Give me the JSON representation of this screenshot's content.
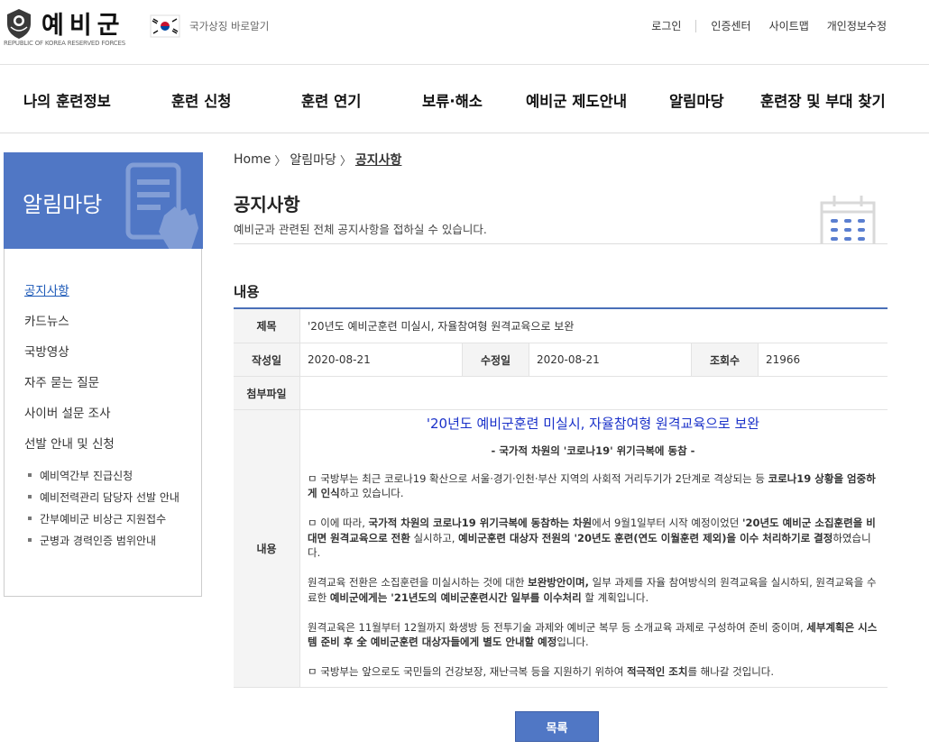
{
  "header": {
    "logo_text": "예비군",
    "logo_sub": "REPUBLIC OF KOREA RESERVED FORCES",
    "symbol_link": "국가상징 바로알기",
    "util": [
      "로그인",
      "인증센터",
      "사이트맵",
      "개인정보수정"
    ]
  },
  "gnb": [
    "나의 훈련정보",
    "훈련 신청",
    "훈련 연기",
    "보류·해소",
    "예비군 제도안내",
    "알림마당",
    "훈련장 및 부대 찾기"
  ],
  "sidebar": {
    "title": "알림마당",
    "items": [
      "공지사항",
      "카드뉴스",
      "국방영상",
      "자주 묻는 질문",
      "사이버 설문 조사",
      "선발 안내 및 신청"
    ],
    "active_index": 0,
    "sub_items": [
      "예비역간부 진급신청",
      "예비전력관리 담당자 선발 안내",
      "간부예비군 비상근 지원접수",
      "군병과 경력인증 범위안내"
    ]
  },
  "breadcrumb": [
    "Home",
    "알림마당",
    "공지사항"
  ],
  "page": {
    "title": "공지사항",
    "desc": "예비군과 관련된 전체 공지사항을 접하실 수 있습니다.",
    "section_title": "내용"
  },
  "post": {
    "labels": {
      "subject": "제목",
      "written": "작성일",
      "modified": "수정일",
      "views": "조회수",
      "attachment": "첨부파일",
      "content": "내용"
    },
    "subject": "'20년도 예비군훈련 미실시, 자율참여형 원격교육으로 보완",
    "written": "2020-08-21",
    "modified": "2020-08-21",
    "views": "21966",
    "attachment": "",
    "body": {
      "heading": "'20년도 예비군훈련 미실시, 자율참여형 원격교육으로 보완",
      "subheading": "- 국가적 차원의 '코로나19' 위기극복에 동참 -",
      "p1_a": "ㅁ 국방부는 최근 코로나19 확산으로 서울·경기·인천·부산 지역의 사회적 거리두기가 2단계로 격상되는 등 ",
      "p1_b": "코로나19 상황을 엄중하게 인식",
      "p1_c": "하고 있습니다.",
      "p2_a": "ㅁ 이에 따라, ",
      "p2_b": "국가적 차원의 코로나19 위기극복에 동참하는 차원",
      "p2_c": "에서 9월1일부터 시작 예정이었던 ",
      "p2_d": "'20년도 예비군 소집훈련을 비대면 원격교육으로 전환",
      "p2_e": " 실시하고, ",
      "p2_f": "예비군훈련 대상자 전원의 '20년도 훈련(연도 이월훈련 제외)을 이수 처리하기로 결정",
      "p2_g": "하였습니다.",
      "p3_a": "원격교육 전환은 소집훈련을 미실시하는 것에 대한 ",
      "p3_b": "보완방안이며,",
      "p3_c": " 일부 과제를 자율 참여방식의 원격교육을 실시하되, 원격교육을 수료한 ",
      "p3_d": "예비군에게는 '21년도의 예비군훈련시간 일부를 이수처리",
      "p3_e": " 할 계획입니다.",
      "p4_a": "원격교육은 11월부터 12월까지 화생방 등 전투기술 과제와 예비군 복무 등 소개교육 과제로 구성하여 준비 중이며, ",
      "p4_b": "세부계획은 시스템 준비 후 全 예비군훈련 대상자들에게 별도 안내할 예정",
      "p4_c": "입니다.",
      "p5_a": "ㅁ 국방부는 앞으로도 국민들의 건강보장, 재난극복 등을 지원하기 위하여 ",
      "p5_b": "적극적인 조치",
      "p5_c": "를 해나갈 것입니다."
    }
  },
  "list_button": "목록",
  "colors": {
    "accent": "#5077c5",
    "heading_blue": "#1a31c9",
    "active_link": "#1f5bb8"
  }
}
